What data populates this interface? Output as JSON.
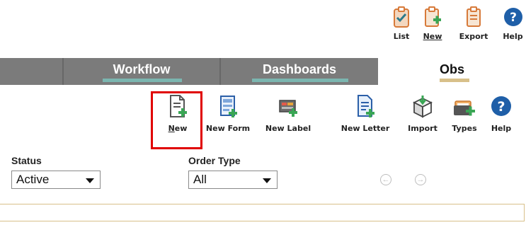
{
  "top_toolbar": {
    "list_label": "List",
    "new_label": "New",
    "export_label": "Export",
    "help_label": "Help"
  },
  "tabs": [
    {
      "label": "Workflow",
      "active": false
    },
    {
      "label": "Dashboards",
      "active": false
    },
    {
      "label": "Obs",
      "active": true
    }
  ],
  "actions": [
    {
      "label": "New",
      "underline": "N",
      "rest": "ew",
      "icon": "new-document-icon",
      "highlighted": true
    },
    {
      "label": "New Form",
      "icon": "new-form-icon"
    },
    {
      "label": "New Label",
      "icon": "new-label-icon"
    },
    {
      "label": "New Letter",
      "icon": "new-letter-icon"
    },
    {
      "label": "Import",
      "icon": "import-icon"
    },
    {
      "label": "Types",
      "icon": "types-icon"
    },
    {
      "label": "Help",
      "icon": "help-icon"
    }
  ],
  "filters": {
    "status_label": "Status",
    "status_value": "Active",
    "order_type_label": "Order Type",
    "order_type_value": "All"
  },
  "colors": {
    "tab_bar": "#7b7b7b",
    "tab_underline": "#7bb6b0",
    "active_tab_underline": "#d8c08a",
    "highlight": "#e00000",
    "help_blue": "#1f5fa8"
  }
}
